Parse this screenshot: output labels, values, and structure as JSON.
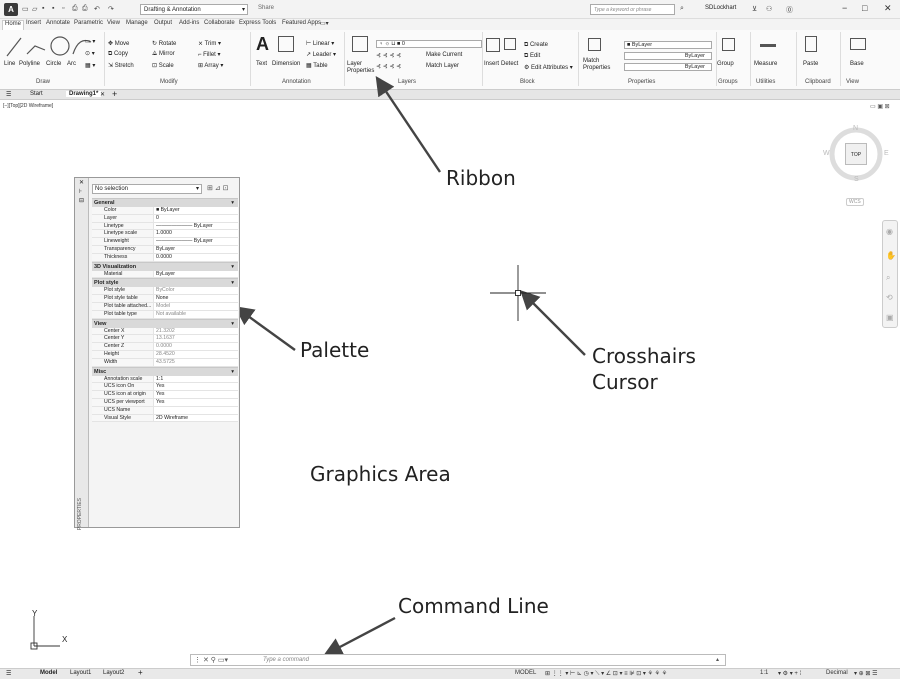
{
  "title_bar": {
    "app_letter": "A",
    "workspace": "Drafting & Annotation",
    "share": "Share",
    "search_placeholder": "Type a keyword or phrase",
    "user": "SDLockhart",
    "min": "−",
    "max": "□",
    "close": "✕"
  },
  "ribbon_tabs": [
    "Home",
    "Insert",
    "Annotate",
    "Parametric",
    "View",
    "Manage",
    "Output",
    "Add-ins",
    "Collaborate",
    "Express Tools",
    "Featured Apps"
  ],
  "ribbon": {
    "draw": {
      "label": "Draw",
      "tools": [
        "Line",
        "Polyline",
        "Circle",
        "Arc"
      ]
    },
    "modify": {
      "label": "Modify",
      "tools": [
        "Move",
        "Rotate",
        "Trim",
        "Copy",
        "Mirror",
        "Fillet",
        "Stretch",
        "Scale",
        "Array"
      ]
    },
    "annotation": {
      "label": "Annotation",
      "tools": [
        "Text",
        "Dimension",
        "Linear",
        "Leader",
        "Table"
      ]
    },
    "layers": {
      "label": "Layers",
      "tools": [
        "Layer Properties",
        "Make Current",
        "Match Layer"
      ],
      "current_layer": "0"
    },
    "block": {
      "label": "Block",
      "tools": [
        "Insert",
        "Detect",
        "Create",
        "Edit",
        "Edit Attributes"
      ]
    },
    "properties": {
      "label": "Properties",
      "tools": [
        "Match Properties"
      ],
      "color": "ByLayer",
      "linetype": "ByLayer",
      "lineweight": "ByLayer"
    },
    "groups": {
      "label": "Groups",
      "tools": [
        "Group"
      ]
    },
    "utilities": {
      "label": "Utilities",
      "tools": [
        "Measure"
      ]
    },
    "clipboard": {
      "label": "Clipboard",
      "tools": [
        "Paste"
      ]
    },
    "view": {
      "label": "View",
      "tools": [
        "Base"
      ]
    }
  },
  "file_tabs": [
    "Start",
    "Drawing1*"
  ],
  "viewport_label": "[−][Top][2D Wireframe]",
  "palette": {
    "selection": "No selection",
    "strip_title": "PROPERTIES",
    "sections": [
      {
        "name": "General",
        "rows": [
          {
            "n": "Color",
            "v": "ByLayer"
          },
          {
            "n": "Layer",
            "v": "0"
          },
          {
            "n": "Linetype",
            "v": "——————— ByLayer"
          },
          {
            "n": "Linetype scale",
            "v": "1.0000"
          },
          {
            "n": "Lineweight",
            "v": "——————— ByLayer"
          },
          {
            "n": "Transparency",
            "v": "ByLayer"
          },
          {
            "n": "Thickness",
            "v": "0.0000"
          }
        ]
      },
      {
        "name": "3D Visualization",
        "rows": [
          {
            "n": "Material",
            "v": "ByLayer"
          }
        ]
      },
      {
        "name": "Plot style",
        "rows": [
          {
            "n": "Plot style",
            "v": "ByColor"
          },
          {
            "n": "Plot style table",
            "v": "None"
          },
          {
            "n": "Plot table attached...",
            "v": "Model"
          },
          {
            "n": "Plot table type",
            "v": "Not available"
          }
        ]
      },
      {
        "name": "View",
        "rows": [
          {
            "n": "Center X",
            "v": "21.3202"
          },
          {
            "n": "Center Y",
            "v": "13.1637"
          },
          {
            "n": "Center Z",
            "v": "0.0000"
          },
          {
            "n": "Height",
            "v": "28.4520"
          },
          {
            "n": "Width",
            "v": "43.5725"
          }
        ]
      },
      {
        "name": "Misc",
        "rows": [
          {
            "n": "Annotation scale",
            "v": "1:1"
          },
          {
            "n": "UCS icon On",
            "v": "Yes"
          },
          {
            "n": "UCS icon at origin",
            "v": "Yes"
          },
          {
            "n": "UCS per viewport",
            "v": "Yes"
          },
          {
            "n": "UCS Name",
            "v": ""
          },
          {
            "n": "Visual Style",
            "v": "2D Wireframe"
          }
        ]
      }
    ]
  },
  "annotations": {
    "ribbon": "Ribbon",
    "palette": "Palette",
    "crosshairs": "Crosshairs",
    "cursor": "Cursor",
    "graphics": "Graphics Area",
    "command": "Command Line"
  },
  "viewcube": {
    "face": "TOP",
    "n": "N",
    "s": "S",
    "e": "E",
    "w": "W",
    "wcs": "WCS"
  },
  "ucs": {
    "x": "X",
    "y": "Y"
  },
  "command_line": {
    "placeholder": "Type a command"
  },
  "status_bar": {
    "tabs": [
      "Model",
      "Layout1",
      "Layout2"
    ],
    "model": "MODEL",
    "scale": "1:1",
    "units": "Decimal"
  }
}
